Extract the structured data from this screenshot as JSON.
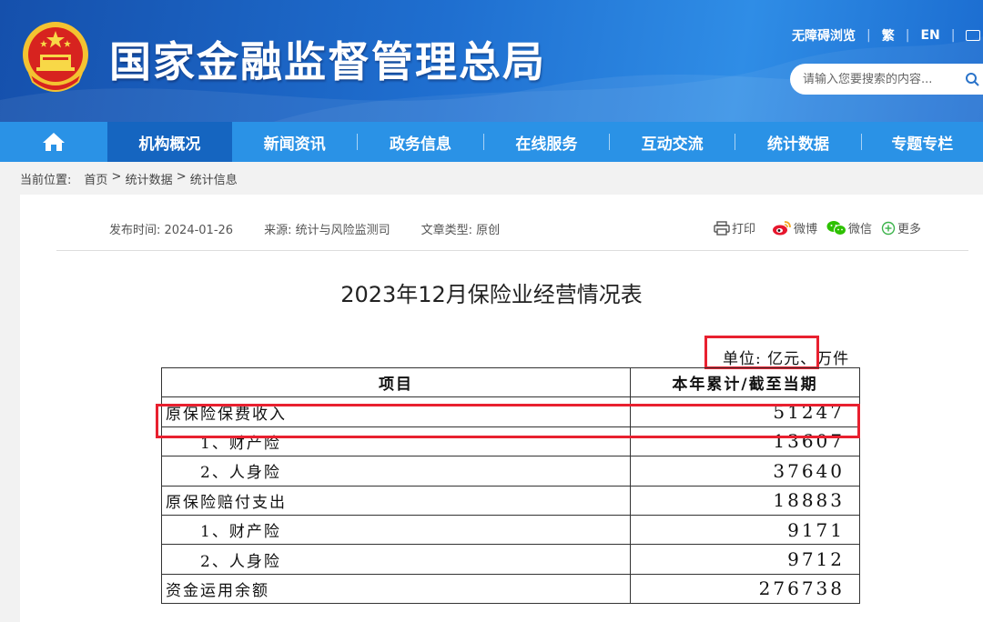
{
  "header": {
    "site_title": "国家金融监督管理总局",
    "top_links": [
      "无障碍浏览",
      "繁",
      "EN"
    ],
    "search_placeholder": "请输入您要搜索的内容..."
  },
  "nav": {
    "items": [
      {
        "label": "机构概况",
        "active": true
      },
      {
        "label": "新闻资讯",
        "active": false
      },
      {
        "label": "政务信息",
        "active": false
      },
      {
        "label": "在线服务",
        "active": false
      },
      {
        "label": "互动交流",
        "active": false
      },
      {
        "label": "统计数据",
        "active": false
      },
      {
        "label": "专题专栏",
        "active": false
      }
    ]
  },
  "breadcrumb": {
    "prefix": "当前位置:",
    "items": [
      "首页",
      "统计数据",
      "统计信息"
    ],
    "separator": " > "
  },
  "article": {
    "publish_time": "发布时间: 2024-01-26",
    "source": "来源: 统计与风险监测司",
    "type": "文章类型: 原创",
    "share": {
      "print": "打印",
      "weibo": "微博",
      "wechat": "微信",
      "more": "更多"
    },
    "title": "2023年12月保险业经营情况表"
  },
  "table": {
    "unit": "单位: 亿元、万件",
    "headers": [
      "项目",
      "本年累计/截至当期"
    ],
    "rows": [
      {
        "item": "原保险保费收入",
        "value": "51247",
        "indent": false
      },
      {
        "item": "1、财产险",
        "value": "13607",
        "indent": true
      },
      {
        "item": "2、人身险",
        "value": "37640",
        "indent": true
      },
      {
        "item": "原保险赔付支出",
        "value": "18883",
        "indent": false
      },
      {
        "item": "1、财产险",
        "value": "9171",
        "indent": true
      },
      {
        "item": "2、人身险",
        "value": "9712",
        "indent": true
      },
      {
        "item": "资金运用余额",
        "value": "276738",
        "indent": false
      }
    ]
  },
  "colors": {
    "header_dark": "#1550ac",
    "nav": "#2a92e6",
    "nav_active": "#1565c0",
    "highlight": "#e8202f"
  }
}
